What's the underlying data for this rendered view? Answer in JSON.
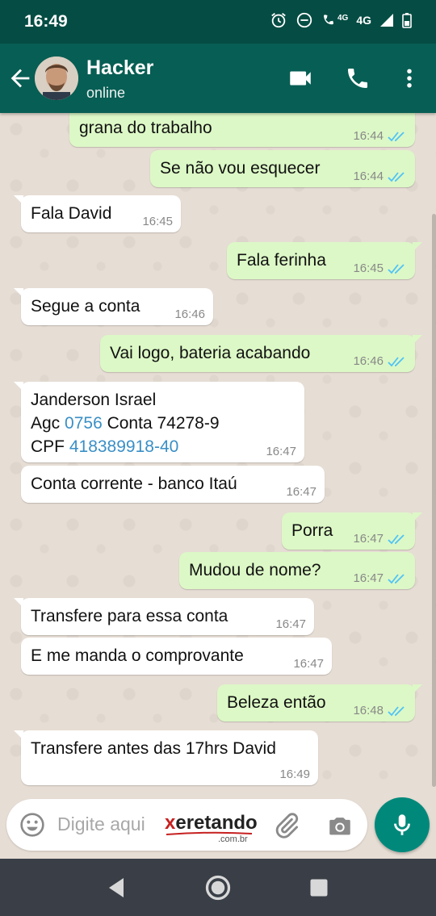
{
  "status_bar": {
    "time": "16:49",
    "network": "4G",
    "network2": "4G"
  },
  "header": {
    "contact_name": "Hacker",
    "contact_status": "online"
  },
  "messages": [
    {
      "dir": "out",
      "text": "grana do trabalho",
      "time": "16:44",
      "read": true
    },
    {
      "dir": "out",
      "text": "Se não vou esquecer",
      "time": "16:44",
      "read": true
    },
    {
      "dir": "in",
      "text": "Fala David",
      "time": "16:45"
    },
    {
      "dir": "out",
      "text": "Fala ferinha",
      "time": "16:45",
      "read": true
    },
    {
      "dir": "in",
      "text": "Segue a conta",
      "time": "16:46"
    },
    {
      "dir": "out",
      "text": "Vai logo, bateria acabando",
      "time": "16:46",
      "read": true
    },
    {
      "dir": "in",
      "line1": "Janderson Israel",
      "line2_a": "Agc ",
      "line2_link": "0756",
      "line2_b": " Conta 74278-9",
      "line3_a": "CPF ",
      "line3_link": "418389918-40",
      "time": "16:47"
    },
    {
      "dir": "in",
      "text": "Conta corrente - banco Itaú",
      "time": "16:47"
    },
    {
      "dir": "out",
      "text": "Porra",
      "time": "16:47",
      "read": true
    },
    {
      "dir": "out",
      "text": "Mudou de nome?",
      "time": "16:47",
      "read": true
    },
    {
      "dir": "in",
      "text": "Transfere para essa conta",
      "time": "16:47"
    },
    {
      "dir": "in",
      "text": "E me manda o comprovante",
      "time": "16:47"
    },
    {
      "dir": "out",
      "text": "Beleza então",
      "time": "16:48",
      "read": true
    },
    {
      "dir": "in",
      "text": "Transfere antes das 17hrs David",
      "time": "16:49"
    }
  ],
  "composer": {
    "placeholder": "Digite aqui",
    "watermark_x": "x",
    "watermark_rest": "eretando",
    "watermark_sub": ".com.br"
  },
  "colors": {
    "header": "#075e54",
    "status_bar": "#054d44",
    "outgoing": "#dcf8c6",
    "incoming": "#ffffff",
    "tick": "#4fc3f7",
    "mic": "#00897b"
  },
  "icons": [
    "back-arrow-icon",
    "video-call-icon",
    "phone-icon",
    "more-vert-icon",
    "emoji-icon",
    "attach-icon",
    "camera-icon",
    "mic-icon",
    "nav-back-icon",
    "nav-home-icon",
    "nav-recents-icon"
  ]
}
